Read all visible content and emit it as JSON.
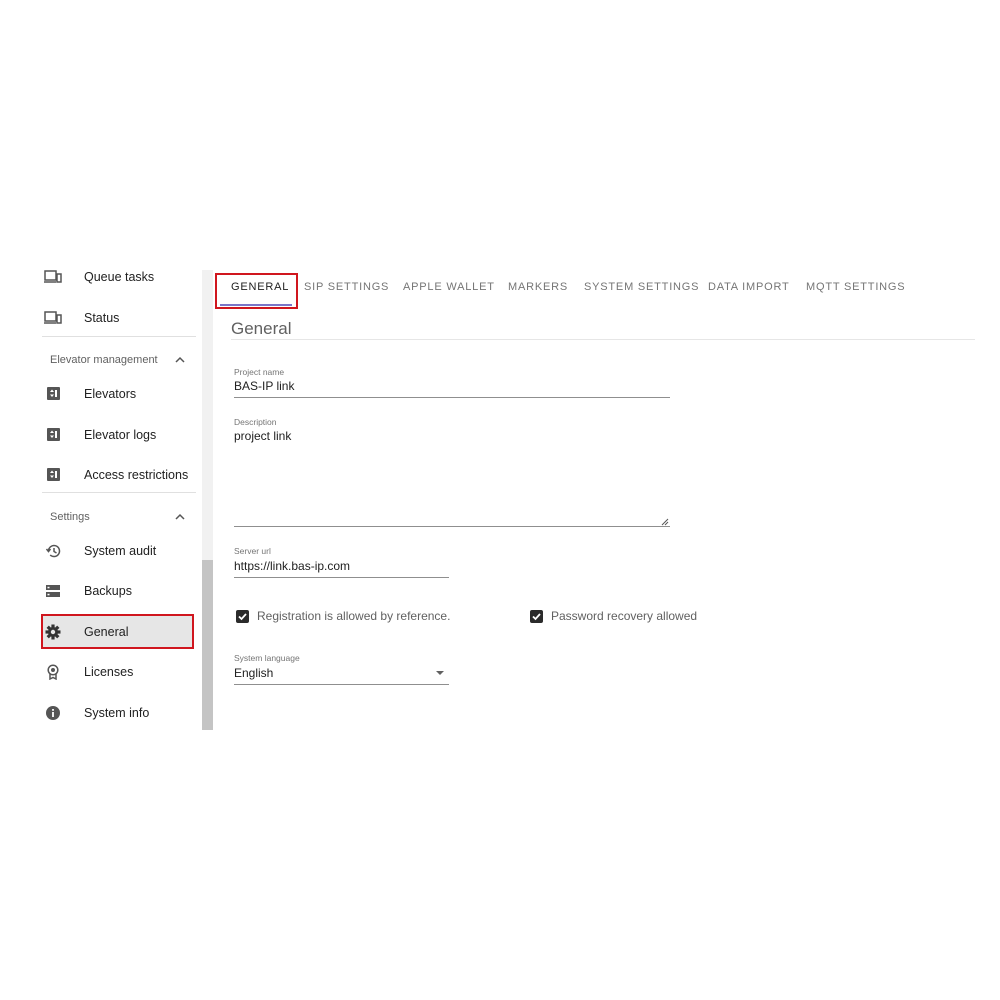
{
  "sidebar": {
    "items_top": [
      {
        "label": "Queue tasks",
        "icon": "devices-icon"
      },
      {
        "label": "Status",
        "icon": "devices-icon"
      }
    ],
    "sections": [
      {
        "title": "Elevator management",
        "items": [
          {
            "label": "Elevators",
            "icon": "elevator-icon"
          },
          {
            "label": "Elevator logs",
            "icon": "elevator-icon"
          },
          {
            "label": "Access restrictions",
            "icon": "elevator-icon"
          }
        ]
      },
      {
        "title": "Settings",
        "items": [
          {
            "label": "System audit",
            "icon": "history-icon"
          },
          {
            "label": "Backups",
            "icon": "storage-icon"
          },
          {
            "label": "General",
            "icon": "gear-icon",
            "active": true
          },
          {
            "label": "Licenses",
            "icon": "award-icon"
          },
          {
            "label": "System info",
            "icon": "info-icon"
          }
        ]
      }
    ]
  },
  "tabs": [
    "GENERAL",
    "SIP SETTINGS",
    "APPLE WALLET",
    "MARKERS",
    "SYSTEM SETTINGS",
    "DATA IMPORT",
    "MQTT SETTINGS"
  ],
  "active_tab": "GENERAL",
  "page_title": "General",
  "form": {
    "project_name": {
      "label": "Project name",
      "value": "BAS-IP link"
    },
    "description": {
      "label": "Description",
      "value": "project link"
    },
    "server_url": {
      "label": "Server url",
      "value": "https://link.bas-ip.com"
    },
    "registration_checkbox": {
      "label": "Registration is allowed by reference.",
      "checked": true
    },
    "password_recovery_checkbox": {
      "label": "Password recovery allowed",
      "checked": true
    },
    "system_language": {
      "label": "System language",
      "value": "English"
    }
  },
  "colors": {
    "highlight": "#d0161e",
    "tab_indicator": "#7a76c8",
    "active_item_bg": "#e6e6e6"
  }
}
